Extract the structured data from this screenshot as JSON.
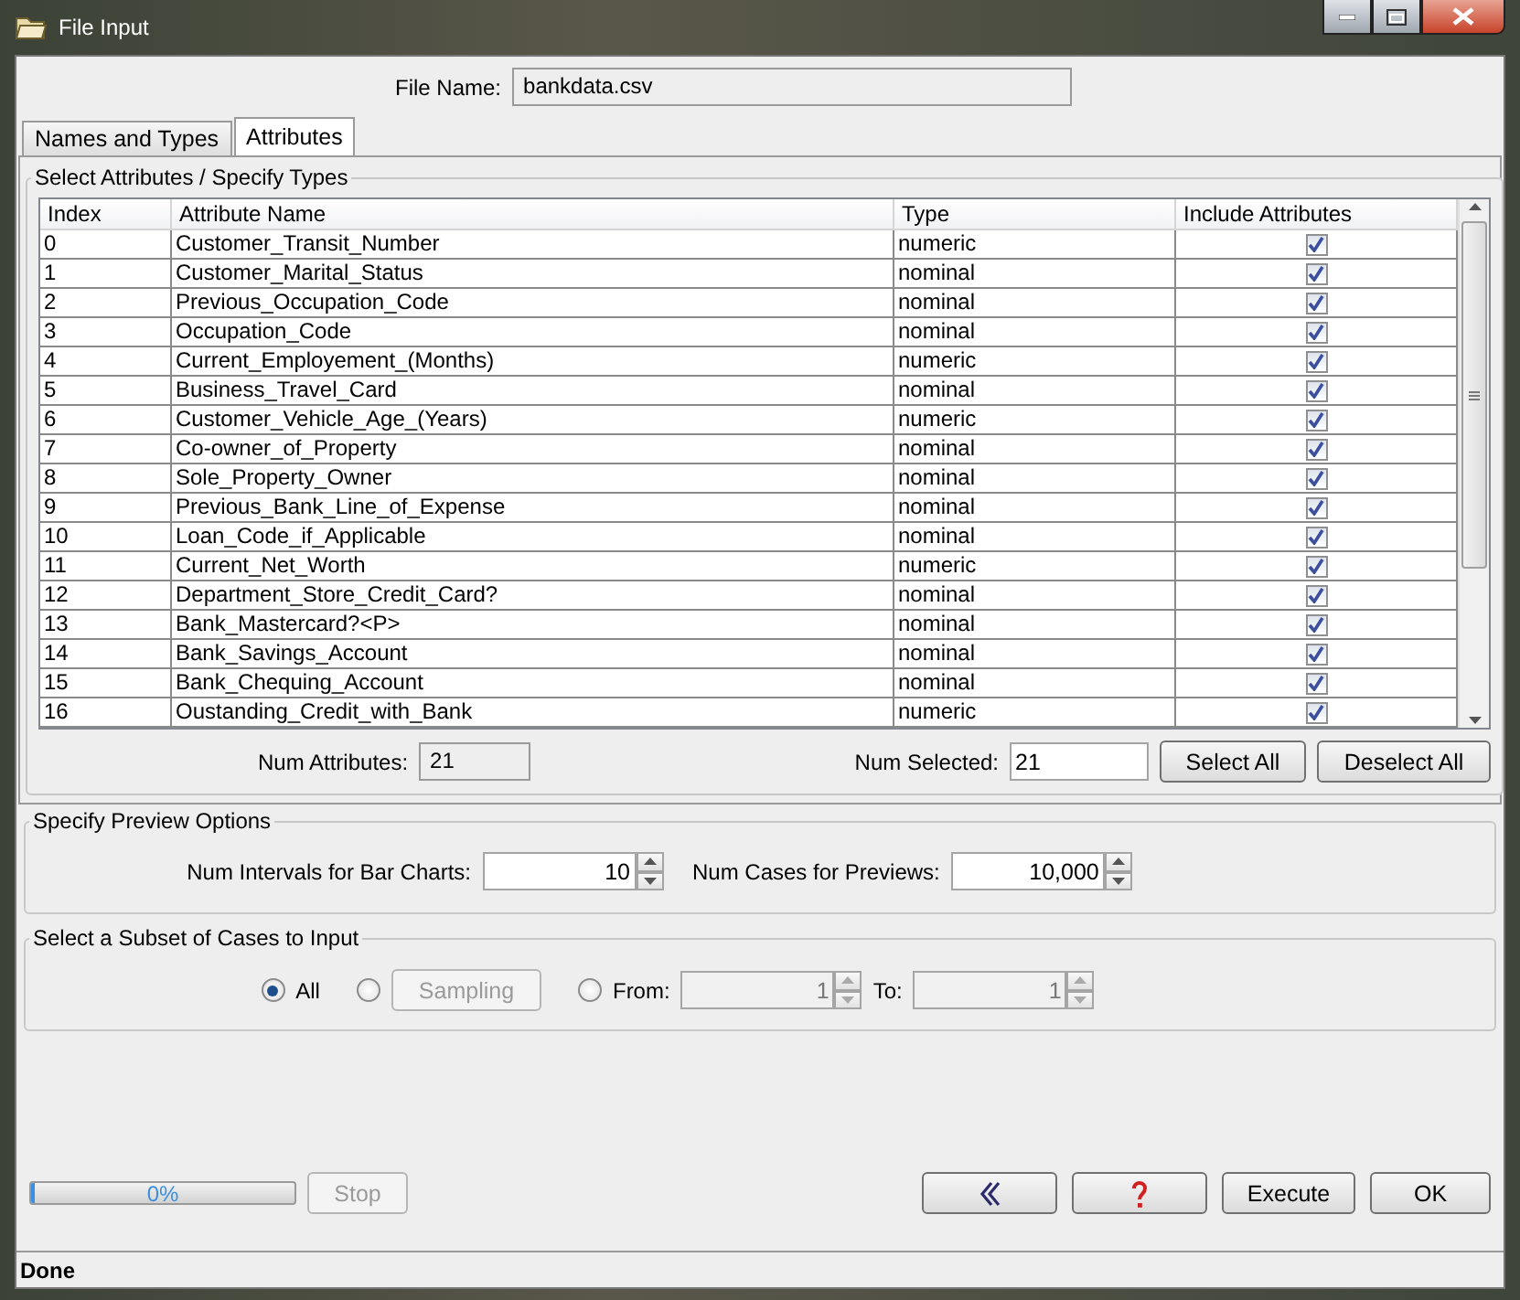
{
  "window": {
    "title": "File Input"
  },
  "file_name": {
    "label": "File Name:",
    "value": "bankdata.csv"
  },
  "tabs": [
    {
      "label": "Names and Types",
      "selected": false
    },
    {
      "label": "Attributes",
      "selected": true
    }
  ],
  "attributes": {
    "title": "Select Attributes / Specify Types",
    "columns": [
      "Index",
      "Attribute Name",
      "Type",
      "Include Attributes"
    ],
    "rows": [
      {
        "index": "0",
        "name": "Customer_Transit_Number",
        "type": "numeric",
        "included": true
      },
      {
        "index": "1",
        "name": "Customer_Marital_Status",
        "type": "nominal",
        "included": true
      },
      {
        "index": "2",
        "name": "Previous_Occupation_Code",
        "type": "nominal",
        "included": true
      },
      {
        "index": "3",
        "name": "Occupation_Code",
        "type": "nominal",
        "included": true
      },
      {
        "index": "4",
        "name": "Current_Employement_(Months)",
        "type": "numeric",
        "included": true
      },
      {
        "index": "5",
        "name": "Business_Travel_Card",
        "type": "nominal",
        "included": true
      },
      {
        "index": "6",
        "name": "Customer_Vehicle_Age_(Years)",
        "type": "numeric",
        "included": true
      },
      {
        "index": "7",
        "name": "Co-owner_of_Property",
        "type": "nominal",
        "included": true
      },
      {
        "index": "8",
        "name": "Sole_Property_Owner",
        "type": "nominal",
        "included": true
      },
      {
        "index": "9",
        "name": "Previous_Bank_Line_of_Expense",
        "type": "nominal",
        "included": true
      },
      {
        "index": "10",
        "name": "Loan_Code_if_Applicable",
        "type": "nominal",
        "included": true
      },
      {
        "index": "11",
        "name": "Current_Net_Worth",
        "type": "numeric",
        "included": true
      },
      {
        "index": "12",
        "name": "Department_Store_Credit_Card?",
        "type": "nominal",
        "included": true
      },
      {
        "index": "13",
        "name": "Bank_Mastercard?<P>",
        "type": "nominal",
        "included": true
      },
      {
        "index": "14",
        "name": "Bank_Savings_Account",
        "type": "nominal",
        "included": true
      },
      {
        "index": "15",
        "name": "Bank_Chequing_Account",
        "type": "nominal",
        "included": true
      },
      {
        "index": "16",
        "name": "Oustanding_Credit_with_Bank",
        "type": "numeric",
        "included": true
      }
    ],
    "num_attributes": {
      "label": "Num Attributes:",
      "value": "21"
    },
    "num_selected": {
      "label": "Num Selected:",
      "value": "21"
    },
    "buttons": [
      "Select All",
      "Deselect All"
    ]
  },
  "preview": {
    "title": "Specify Preview Options",
    "intervals": {
      "label": "Num Intervals for Bar Charts:",
      "value": "10"
    },
    "cases": {
      "label": "Num Cases for Previews:",
      "value": "10,000"
    }
  },
  "subset": {
    "title": "Select a Subset of Cases to Input",
    "radios": [
      {
        "label": "All",
        "selected": true
      },
      {
        "selected": false
      },
      {
        "label": "From:",
        "selected": false
      }
    ],
    "sampling_button": "Sampling",
    "range_disabled": true,
    "from_value": "1",
    "to_label": "To:",
    "to_value": "1"
  },
  "progress": {
    "level": 0,
    "label": "0%"
  },
  "stop_button": {
    "label": "Stop",
    "disabled": true
  },
  "buttons": [
    {
      "kind": "back"
    },
    {
      "kind": "help"
    },
    {
      "kind": "text",
      "label": "Execute"
    },
    {
      "kind": "text",
      "label": "OK"
    }
  ],
  "status_bar": "Done"
}
